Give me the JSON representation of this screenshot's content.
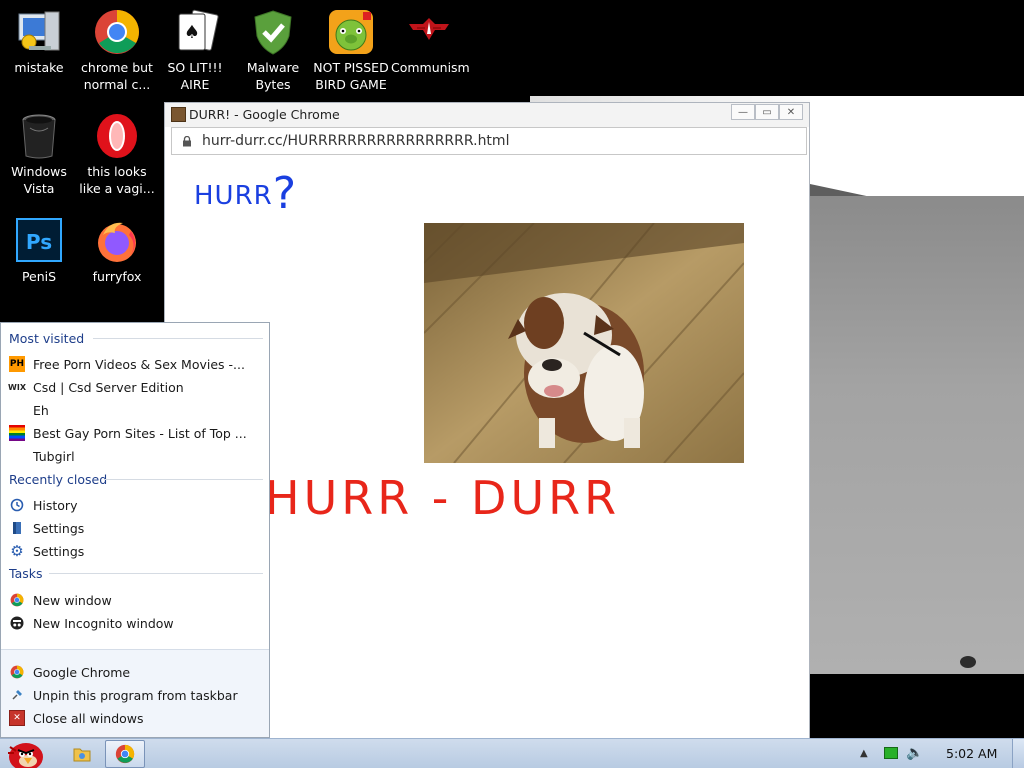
{
  "desktop": {
    "top_icons": [
      {
        "icon": "mistake-computer-icon",
        "label": "mistake"
      },
      {
        "icon": "chrome-icon",
        "label": "chrome but\nnormal c..."
      },
      {
        "icon": "solitaire-cards-icon",
        "label": "SO LIT!!!\nAIRE"
      },
      {
        "icon": "shield-check-icon",
        "label": "Malware\nBytes"
      },
      {
        "icon": "angry-bird-pig-icon",
        "label": "NOT PISSED\nBIRD GAME"
      },
      {
        "icon": "communism-emblem-icon",
        "label": "Communism"
      }
    ],
    "side_icons": [
      {
        "icon": "trash-bin-icon",
        "label": "Windows\nVista"
      },
      {
        "icon": "opera-icon",
        "label": "this looks\nlike a vagi..."
      },
      {
        "icon": "photoshop-icon",
        "label": "PeniS"
      },
      {
        "icon": "firefox-icon",
        "label": "furryfox"
      }
    ]
  },
  "window": {
    "title": "DURR! - Google Chrome",
    "url": "hurr-durr.cc/HURRRRRRRRRRRRRRRRR.html",
    "page": {
      "heading": "HURR",
      "heading_mark": "?",
      "banner": "HURR - DURR",
      "image_alt": "bulldog"
    }
  },
  "jumplist": {
    "most_visited_title": "Most visited",
    "most_visited": [
      {
        "icon": "PH",
        "label": "Free Porn Videos & Sex Movies -..."
      },
      {
        "icon": "WIX",
        "label": "Csd | Csd Server Edition"
      },
      {
        "icon": "",
        "label": "Eh"
      },
      {
        "icon": "rainbow",
        "label": "Best Gay Porn Sites - List of Top ..."
      },
      {
        "icon": "",
        "label": "Tubgirl"
      }
    ],
    "recently_closed_title": "Recently closed",
    "recently_closed": [
      {
        "icon": "history-icon",
        "label": "History"
      },
      {
        "icon": "settings-page-icon",
        "label": "Settings"
      },
      {
        "icon": "gear-icon",
        "label": "Settings"
      }
    ],
    "tasks_title": "Tasks",
    "tasks": [
      {
        "icon": "chrome-icon",
        "label": "New window"
      },
      {
        "icon": "incognito-icon",
        "label": "New Incognito window"
      }
    ],
    "footer": [
      {
        "icon": "chrome-icon",
        "label": "Google Chrome"
      },
      {
        "icon": "pin-icon",
        "label": "Unpin this program from taskbar"
      },
      {
        "icon": "close-icon",
        "label": "Close all windows"
      }
    ]
  },
  "taskbar": {
    "clock": "5:02 AM"
  }
}
